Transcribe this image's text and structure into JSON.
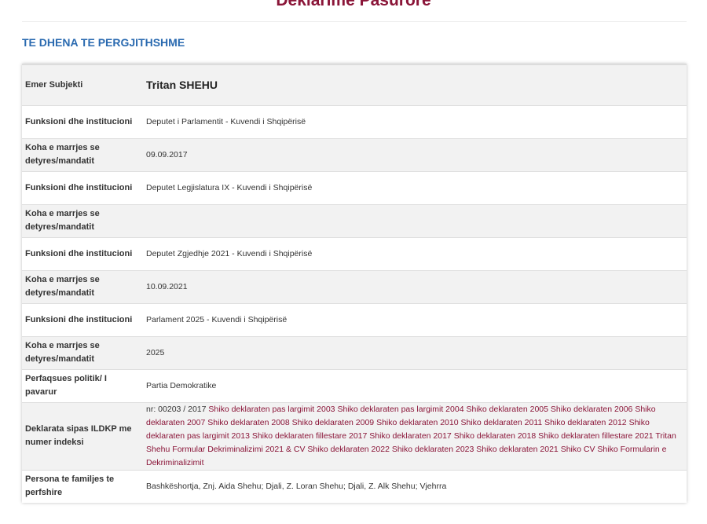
{
  "page": {
    "title": "Deklarime Pasurore",
    "section_heading": "TE DHENA TE PERGJITHSHME"
  },
  "table": {
    "subject": {
      "label": "Emer Subjekti",
      "value": "Tritan SHEHU"
    },
    "rows": [
      {
        "label": "Funksioni dhe institucioni",
        "value": "Deputet i Parlamentit - Kuvendi i Shqipërisë"
      },
      {
        "label": "Koha e marrjes se detyres/mandatit",
        "value": "09.09.2017"
      },
      {
        "label": "Funksioni dhe institucioni",
        "value": "Deputet Legjislatura IX - Kuvendi i Shqipërisë"
      },
      {
        "label": "Koha e marrjes se detyres/mandatit",
        "value": ""
      },
      {
        "label": "Funksioni dhe institucioni",
        "value": "Deputet Zgjedhje 2021 - Kuvendi i Shqipërisë"
      },
      {
        "label": "Koha e marrjes se detyres/mandatit",
        "value": "10.09.2021"
      },
      {
        "label": "Funksioni dhe institucioni",
        "value": "Parlament 2025 - Kuvendi i Shqipërisë"
      },
      {
        "label": "Koha e marrjes se detyres/mandatit",
        "value": "2025"
      },
      {
        "label": "Perfaqsues politik/ I pavarur",
        "value": "Partia Demokratike"
      }
    ],
    "declarations": {
      "label": "Deklarata sipas ILDKP me numer indeksi",
      "prefix": "nr: 00203 / 2017",
      "links": [
        "Shiko deklaraten pas largimit 2003",
        "Shiko deklaraten pas largimit 2004",
        "Shiko deklaraten 2005",
        "Shiko deklaraten 2006",
        "Shiko deklaraten 2007",
        "Shiko deklaraten 2008",
        "Shiko deklaraten 2009",
        "Shiko deklaraten 2010",
        "Shiko deklaraten 2011",
        "Shiko deklaraten 2012",
        "Shiko deklaraten pas largimit 2013",
        "Shiko deklaraten fillestare 2017",
        "Shiko deklaraten 2017",
        "Shiko deklaraten 2018",
        "Shiko deklaraten fillestare 2021",
        "Tritan Shehu Formular Dekriminalizimi 2021 & CV",
        "Shiko deklaraten 2022",
        "Shiko deklaraten 2023",
        "Shiko deklaraten 2021",
        "Shiko CV",
        "Shiko Formularin e Dekriminalizimit"
      ]
    },
    "family": {
      "label": "Persona te familjes te perfshire",
      "value": "Bashkëshortja, Znj. Aida Shehu; Djali, Z. Loran Shehu; Djali, Z. Alk Shehu; Vjehrra"
    }
  }
}
